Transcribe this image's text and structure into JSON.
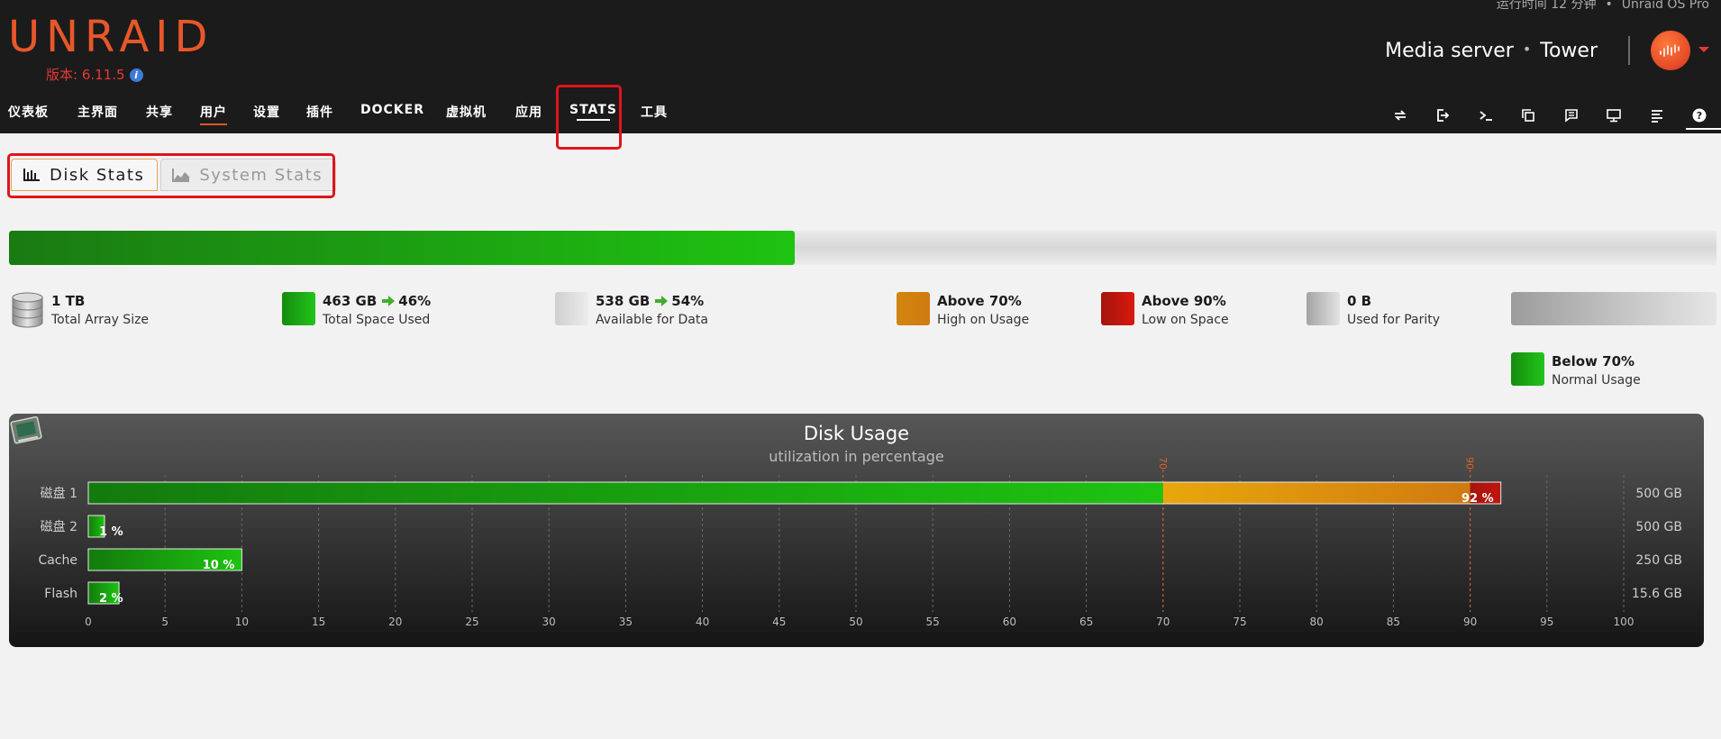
{
  "header": {
    "status_uptime": "运行时间 12 分钟",
    "status_license": "Unraid OS Pro",
    "logo": "UNRAID",
    "version": "版本: 6.11.5",
    "server_description": "Media server",
    "server_name": "Tower"
  },
  "nav": {
    "items": [
      "仪表板",
      "主界面",
      "共享",
      "用户",
      "设置",
      "插件",
      "DOCKER",
      "虚拟机",
      "应用",
      "STATS",
      "工具"
    ],
    "active_index": 3,
    "highlighted_index": 9,
    "right_icons": [
      "switch-icon",
      "logout-icon",
      "terminal-icon",
      "copy-icon",
      "feedback-icon",
      "monitor-icon",
      "log-icon",
      "help-icon"
    ]
  },
  "tabs": {
    "disk_stats": "Disk Stats",
    "system_stats": "System Stats"
  },
  "capacity": {
    "used_fraction": 0.46
  },
  "legend": {
    "array_size_value": "1 TB",
    "array_size_label": "Total Array Size",
    "used_value": "463 GB",
    "used_percent": "46%",
    "used_label": "Total Space Used",
    "free_value": "538 GB",
    "free_percent": "54%",
    "free_label": "Available for Data",
    "high_value": "Above 70%",
    "high_label": "High on Usage",
    "low_value": "Above 90%",
    "low_label": "Low on Space",
    "parity_value": "0 B",
    "parity_label": "Used for Parity",
    "normal_value": "Below 70%",
    "normal_label": "Normal Usage"
  },
  "chart_data": {
    "type": "bar",
    "orientation": "horizontal",
    "title": "Disk Usage",
    "subtitle": "utilization in percentage",
    "categories": [
      "磁盘 1",
      "磁盘 2",
      "Cache",
      "Flash"
    ],
    "values": [
      92,
      1,
      10,
      2
    ],
    "value_labels": [
      "92 %",
      "1 %",
      "10 %",
      "2 %"
    ],
    "capacities": [
      "500 GB",
      "500 GB",
      "250 GB",
      "15.6 GB"
    ],
    "xlim": [
      0,
      100
    ],
    "xticks": [
      0,
      5,
      10,
      15,
      20,
      25,
      30,
      35,
      40,
      45,
      50,
      55,
      60,
      65,
      70,
      75,
      80,
      85,
      90,
      95,
      100
    ],
    "thresholds": [
      70,
      90
    ],
    "grid": true,
    "colors": {
      "normal": "#1ec311",
      "high": "#e8a70c",
      "critical": "#c0150d"
    }
  }
}
